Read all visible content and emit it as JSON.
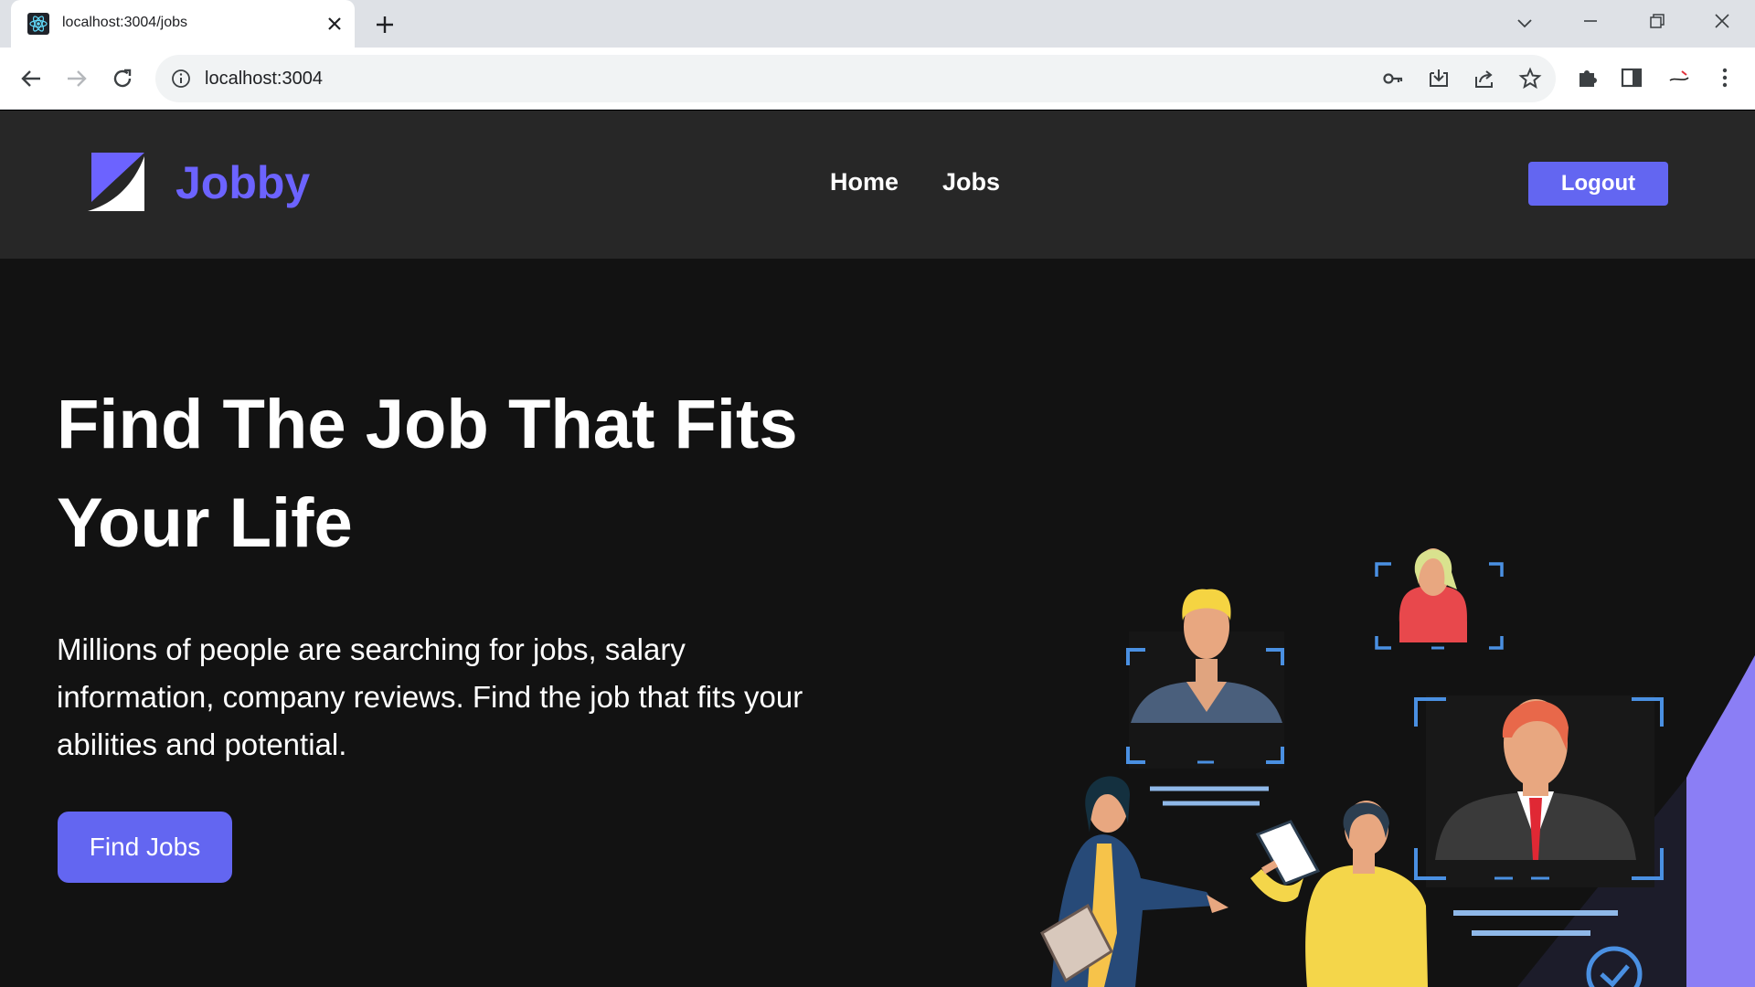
{
  "browser": {
    "tab_title": "localhost:3004/jobs",
    "url": "localhost:3004"
  },
  "site": {
    "logo_text": "Jobby",
    "nav": {
      "home": "Home",
      "jobs": "Jobs"
    },
    "logout_label": "Logout"
  },
  "hero": {
    "title": "Find The Job That Fits Your Life",
    "description": "Millions of people are searching for jobs, salary information, company reviews. Find the job that fits your abilities and potential.",
    "button_label": "Find Jobs"
  },
  "colors": {
    "accent": "#6366f1",
    "logo": "#6c63ff",
    "header_bg": "#272727",
    "page_bg": "#121212"
  }
}
